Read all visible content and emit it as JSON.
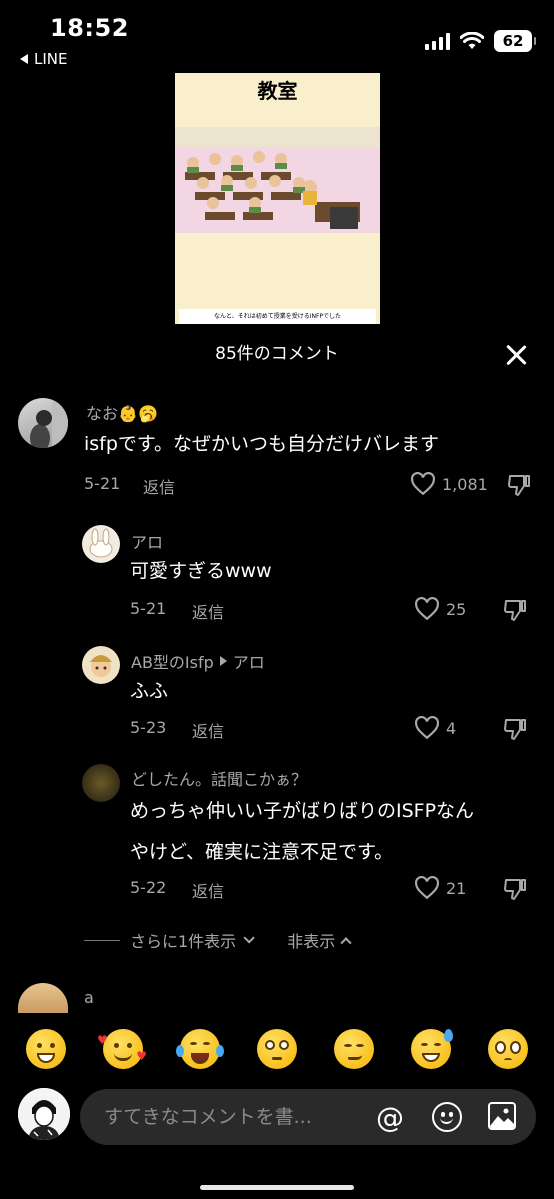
{
  "status_bar": {
    "time": "18:52",
    "back_app": "LINE",
    "battery": "62"
  },
  "video": {
    "title": "教室",
    "caption": "なんと、それは初めて授業を受けるINFPでした"
  },
  "comments_header": {
    "count_label": "85件のコメント"
  },
  "comments": [
    {
      "name": "なお",
      "text": "isfpです。なぜかいつも自分だけバレます",
      "date": "5-21",
      "reply": "返信",
      "likes": "1,081",
      "emoji": "👶🥱"
    },
    {
      "name": "アロ",
      "text": "可愛すぎるwww",
      "date": "5-21",
      "reply": "返信",
      "likes": "25"
    },
    {
      "name": "AB型のIsfp",
      "reply_to": "アロ",
      "text": "ふふ",
      "date": "5-23",
      "reply": "返信",
      "likes": "4"
    },
    {
      "name": "どしたん。話聞こかぁ？",
      "text_line1": "めっちゃ仲いい子がばりばりのISFPなん",
      "text_line2": "やけど、確実に注意不足です。",
      "date": "5-22",
      "reply": "返信",
      "likes": "21"
    }
  ],
  "more": {
    "show_more": "さらに1件表示",
    "hide": "非表示"
  },
  "next_comment": {
    "name": "a"
  },
  "emoji_bar": [
    "grin",
    "smiling-hearts",
    "tears-of-joy",
    "flushed",
    "smirk",
    "sweat-smile",
    "pleading"
  ],
  "input": {
    "placeholder": "すてきなコメントを書..."
  }
}
